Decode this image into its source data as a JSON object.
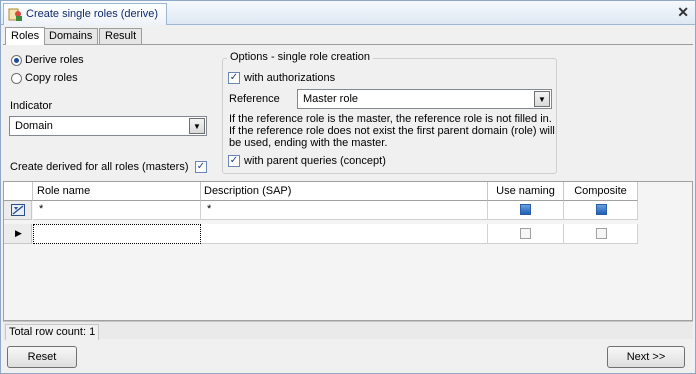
{
  "window": {
    "title": "Create single roles (derive)",
    "close_glyph": "✕"
  },
  "tabs": [
    {
      "label": "Roles",
      "active": true
    },
    {
      "label": "Domains",
      "active": false
    },
    {
      "label": "Result",
      "active": false
    }
  ],
  "mode": {
    "derive_label": "Derive roles",
    "copy_label": "Copy roles",
    "selected": "Derive roles"
  },
  "indicator": {
    "label": "Indicator",
    "value": "Domain"
  },
  "create_derived": {
    "label": "Create derived for all roles (masters)",
    "checked": true
  },
  "options": {
    "title": "Options - single role creation",
    "with_authorizations": {
      "label": "with authorizations",
      "checked": true
    },
    "reference_label": "Reference",
    "reference_value": "Master role",
    "info_text": "If the reference role is the master, the reference role is not filled in. If the reference role does not exist the first parent domain (role) will be used, ending with the master.",
    "with_parent_queries": {
      "label": "with parent queries (concept)",
      "checked": true
    }
  },
  "grid": {
    "columns": [
      "Role name",
      "Description (SAP)",
      "Use naming",
      "Composite"
    ],
    "filter_row": {
      "role_name": "*",
      "description": "*",
      "use_naming": true,
      "composite": true
    },
    "rows": [
      {
        "role_name": "",
        "description": "",
        "use_naming": false,
        "composite": false
      }
    ]
  },
  "status": {
    "row_count_label": "Total row count: 1"
  },
  "buttons": {
    "reset": "Reset",
    "next": "Next >>"
  },
  "colors": {
    "accent": "#1b4d9c",
    "titlebar": "#dfe8f3"
  }
}
